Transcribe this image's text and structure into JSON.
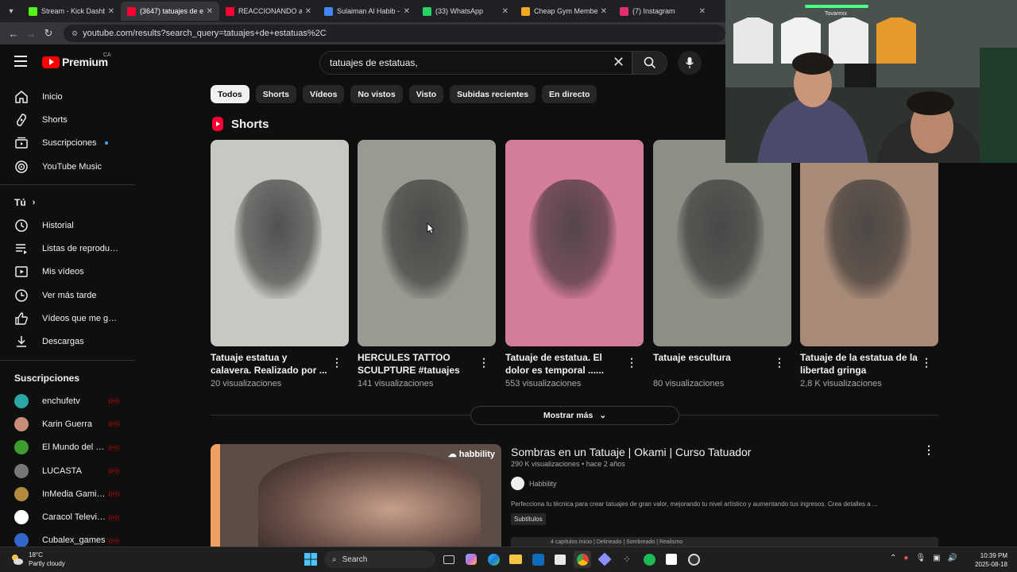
{
  "browser": {
    "tabs": [
      {
        "title": "Stream - Kick Dashbo",
        "color": "#53fc18"
      },
      {
        "title": "(3647) tatuajes de est",
        "color": "#ff0033",
        "active": true
      },
      {
        "title": "REACCIONANDO a lo",
        "color": "#ff0033"
      },
      {
        "title": "Sulaiman Al Habib - I",
        "color": "#4285f4"
      },
      {
        "title": "(33) WhatsApp",
        "color": "#25d366"
      },
      {
        "title": "Cheap Gym Member",
        "color": "#f5a623"
      },
      {
        "title": "(7) Instagram",
        "color": "#e1306c"
      }
    ],
    "url": "youtube.com/results?search_query=tatuajes+de+estatuas%2C"
  },
  "header": {
    "logo": "Premium",
    "country": "CA",
    "search_value": "tatuajes de estatuas,"
  },
  "sidebar": {
    "main": [
      {
        "label": "Inicio",
        "icon": "home-icon"
      },
      {
        "label": "Shorts",
        "icon": "shorts-icon"
      },
      {
        "label": "Suscripciones",
        "icon": "subscriptions-icon"
      },
      {
        "label": "YouTube Music",
        "icon": "music-icon"
      }
    ],
    "you_label": "Tú",
    "you": [
      {
        "label": "Historial",
        "icon": "history-icon"
      },
      {
        "label": "Listas de reproducc...",
        "icon": "playlist-icon"
      },
      {
        "label": "Mis vídeos",
        "icon": "my-videos-icon"
      },
      {
        "label": "Ver más tarde",
        "icon": "watch-later-icon"
      },
      {
        "label": "Vídeos que me gus...",
        "icon": "like-icon"
      },
      {
        "label": "Descargas",
        "icon": "download-icon"
      }
    ],
    "subs_label": "Suscripciones",
    "subs": [
      {
        "label": "enchufetv",
        "color": "#2ba5a5"
      },
      {
        "label": "Karin Guerra",
        "color": "#c88c78"
      },
      {
        "label": "El Mundo del Ca...",
        "color": "#3f9c2e"
      },
      {
        "label": "LUCASTA",
        "color": "#777777"
      },
      {
        "label": "InMedia Gaming ...",
        "color": "#b08a3e"
      },
      {
        "label": "Caracol Televisión",
        "color": "#ffffff"
      },
      {
        "label": "Cubalex_games",
        "color": "#3366cc"
      }
    ]
  },
  "chips": [
    "Todos",
    "Shorts",
    "Vídeos",
    "No vistos",
    "Visto",
    "Subidas recientes",
    "En directo"
  ],
  "shorts": {
    "section_title": "Shorts",
    "items": [
      {
        "title": "Tatuaje estatua y calavera. Realizado por ...",
        "views": "20 visualizaciones",
        "bg": "#c9c7c2"
      },
      {
        "title": "HERCULES TATTOO SCULPTURE #tatuajes #in...",
        "views": "141 visualizaciones",
        "bg": "#9a9a92"
      },
      {
        "title": "Tatuaje de estatua. El dolor es temporal ...... #tattoo ...",
        "views": "553 visualizaciones",
        "bg": "#d47d9a"
      },
      {
        "title": "Tatuaje escultura",
        "views": "80 visualizaciones",
        "bg": "#8d8f86"
      },
      {
        "title": "Tatuaje de la estatua de la libertad gringa",
        "views": "2,8 K visualizaciones",
        "bg": "#a88a78"
      }
    ],
    "show_more": "Mostrar más"
  },
  "video": {
    "title": "Sombras en un Tatuaje | Okami | Curso Tatuador",
    "meta": "290 K visualizaciones • hace 2 años",
    "channel": "Habbility",
    "thumb_brand": "habbility",
    "description": "Perfecciona tu técnica para crear tatuajes de gran valor, mejorando tu nivel artístico y aumentando tus ingresos. Crea detalles a ...",
    "badge": "Subtítulos",
    "chapters": "4 capítulos   Inicio | Delineado | Sombreado | Realismo"
  },
  "taskbar": {
    "temp": "18°C",
    "weather": "Partly cloudy",
    "search": "Search",
    "time": "10:39 PM",
    "date": "2025-08-18"
  },
  "webcam": {
    "label": "Tovarexx"
  }
}
